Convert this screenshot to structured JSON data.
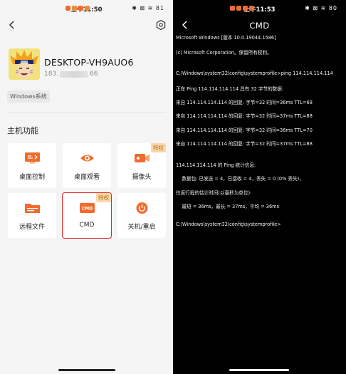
{
  "left": {
    "status_time": "上午11:50",
    "status_right": "✱ ⊠ ≋ 81",
    "device": {
      "name": "DESKTOP-VH9AUO6",
      "ip_prefix": "183.",
      "ip_suffix": "66",
      "os_tag": "Windows系统"
    },
    "section_title": "主机功能",
    "features": [
      {
        "label": "桌面控制",
        "icon": "desktop-control-icon",
        "badge": ""
      },
      {
        "label": "桌面观看",
        "icon": "eye-icon",
        "badge": ""
      },
      {
        "label": "摄像头",
        "icon": "camera-icon",
        "badge": "特权"
      },
      {
        "label": "远程文件",
        "icon": "folder-icon",
        "badge": ""
      },
      {
        "label": "CMD",
        "icon": "cmd-icon",
        "badge": "特权",
        "selected": true
      },
      {
        "label": "关机/重启",
        "icon": "power-icon",
        "badge": ""
      }
    ],
    "accent_color": "#f26b2e",
    "selection_color": "#e0252b"
  },
  "right": {
    "status_time": "上午11:53",
    "status_right": "✱ ⊠ ≋ 80",
    "title": "CMD",
    "lines": [
      "Microsoft Windows [版本 10.0.19044.1586]",
      "(c) Microsoft Corporation。保留所有权利。",
      "",
      "C:\\Windows\\system32\\config\\systemprofile>ping 114.114.114.114",
      "正在 Ping 114.114.114.114 具有 32 字节的数据:",
      "来自 114.114.114.114 的回复: 字节=32 时间=36ms TTL=68",
      "来自 114.114.114.114 的回复: 字节=32 时间=37ms TTL=88",
      "来自 114.114.114.114 的回复: 字节=32 时间=36ms TTL=70",
      "来自 114.114.114.114 的回复: 字节=32 时间=37ms TTL=88",
      "",
      "114.114.114.114 的 Ping 统计信息:",
      "    数据包: 已发送 = 4，已接收 = 4，丢失 = 0 (0% 丢失)，",
      "往返行程的估计时间(以毫秒为单位):",
      "    最短 = 36ms，最长 = 37ms，平均 = 36ms",
      "",
      "C:\\Windows\\system32\\config\\systemprofile>"
    ]
  }
}
